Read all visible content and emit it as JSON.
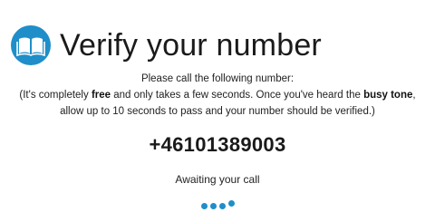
{
  "header": {
    "title": "Verify your number",
    "logo_icon": "open-book-icon"
  },
  "instructions": {
    "line1": "Please call the following number:",
    "line2_pre": "(It's completely ",
    "line2_free": "free",
    "line2_mid": " and only takes a few seconds. Once you've heard the ",
    "line2_busy": "busy tone",
    "line2_post": ",",
    "line3": "allow up to 10 seconds to pass and your number should be verified.)"
  },
  "phone_number": "+46101389003",
  "status_text": "Awaiting your call",
  "loader": {
    "dot_count": 4,
    "raised_dot": 4
  },
  "colors": {
    "accent": "#1f8ec9",
    "text": "#1a1a1a"
  }
}
